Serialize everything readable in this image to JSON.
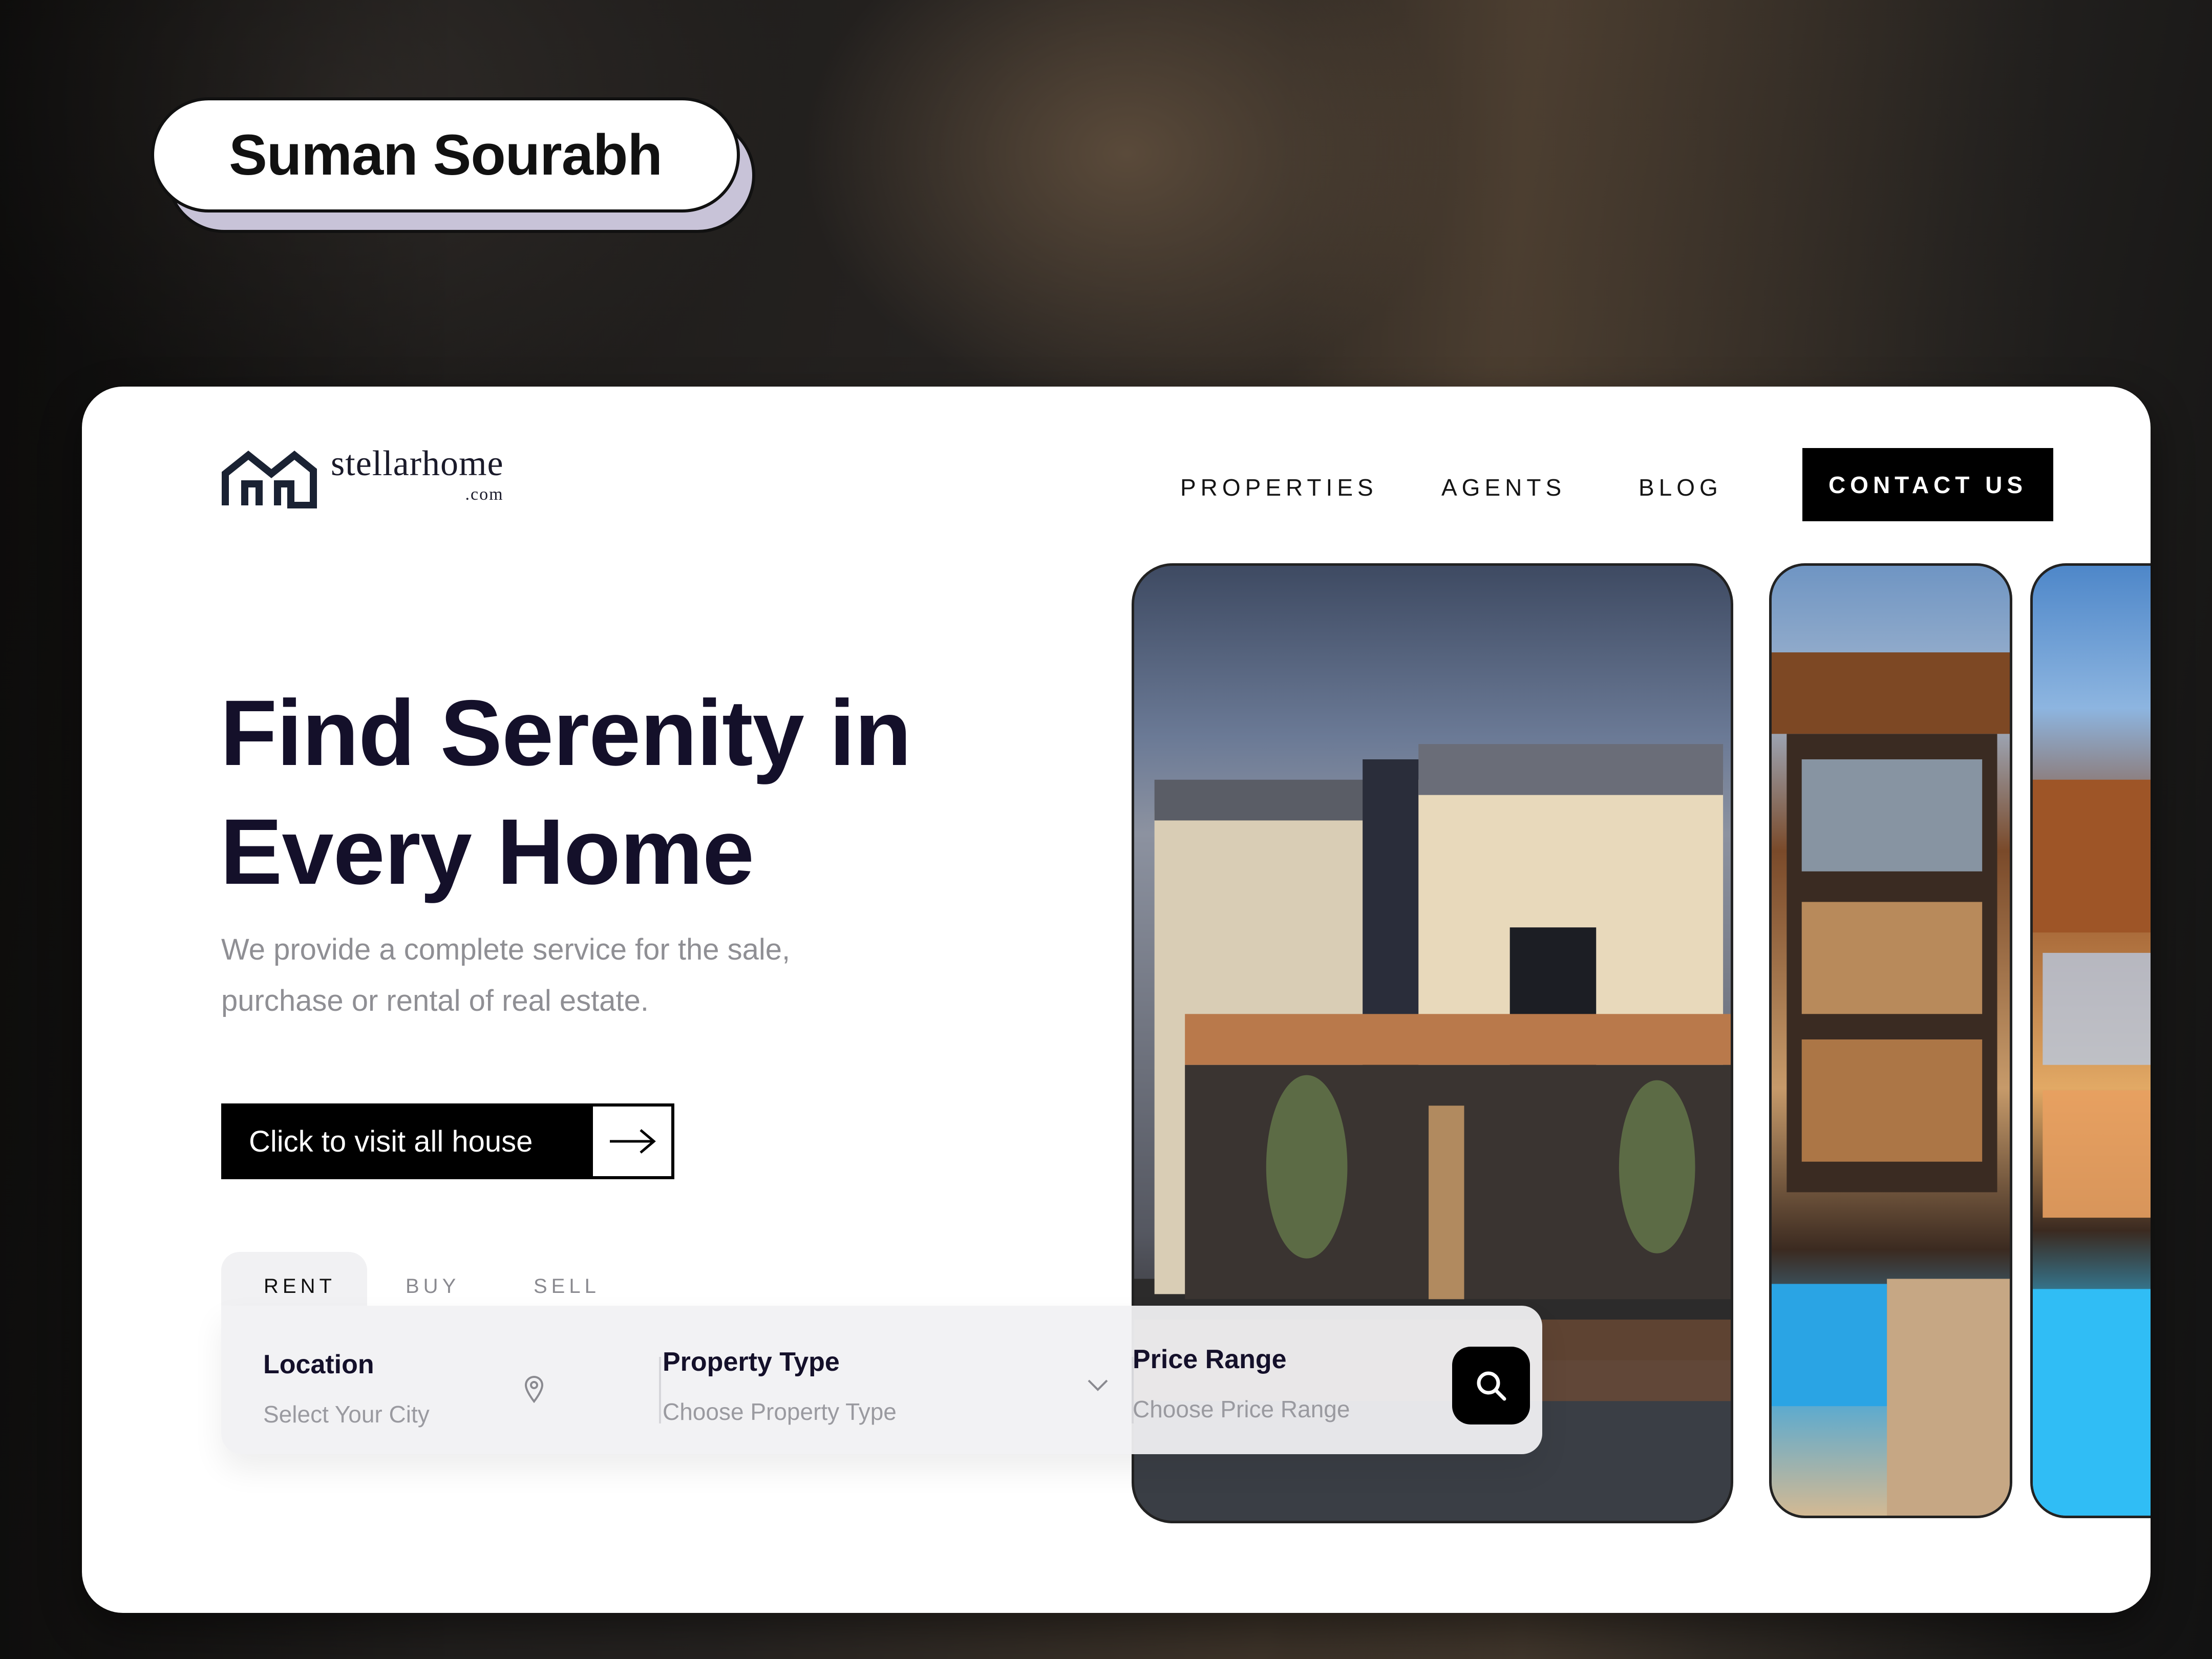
{
  "author": {
    "name": "Suman Sourabh"
  },
  "brand": {
    "name": "stellarhome",
    "tld": ".com"
  },
  "nav": {
    "items": [
      "PROPERTIES",
      "AGENTS",
      "BLOG"
    ],
    "contact": "CONTACT US"
  },
  "hero": {
    "headline_line1": "Find Serenity in",
    "headline_line2": "Every Home",
    "sub_line1": "We provide a complete service for the sale,",
    "sub_line2": "purchase or rental of real estate.",
    "cta": "Click to visit all house"
  },
  "search": {
    "tabs": [
      "RENT",
      "BUY",
      "SELL"
    ],
    "active_tab": "RENT",
    "fields": [
      {
        "label": "Location",
        "placeholder": "Select Your City",
        "icon": "location-pin-icon"
      },
      {
        "label": "Property Type",
        "placeholder": "Choose Property Type",
        "icon": "chevron-down-icon"
      },
      {
        "label": "Price Range",
        "placeholder": "Choose Price Range"
      }
    ],
    "button_icon": "search-icon"
  },
  "colors": {
    "headline": "#14102a",
    "accent": "#000000",
    "panel": "#f1f1f3"
  }
}
